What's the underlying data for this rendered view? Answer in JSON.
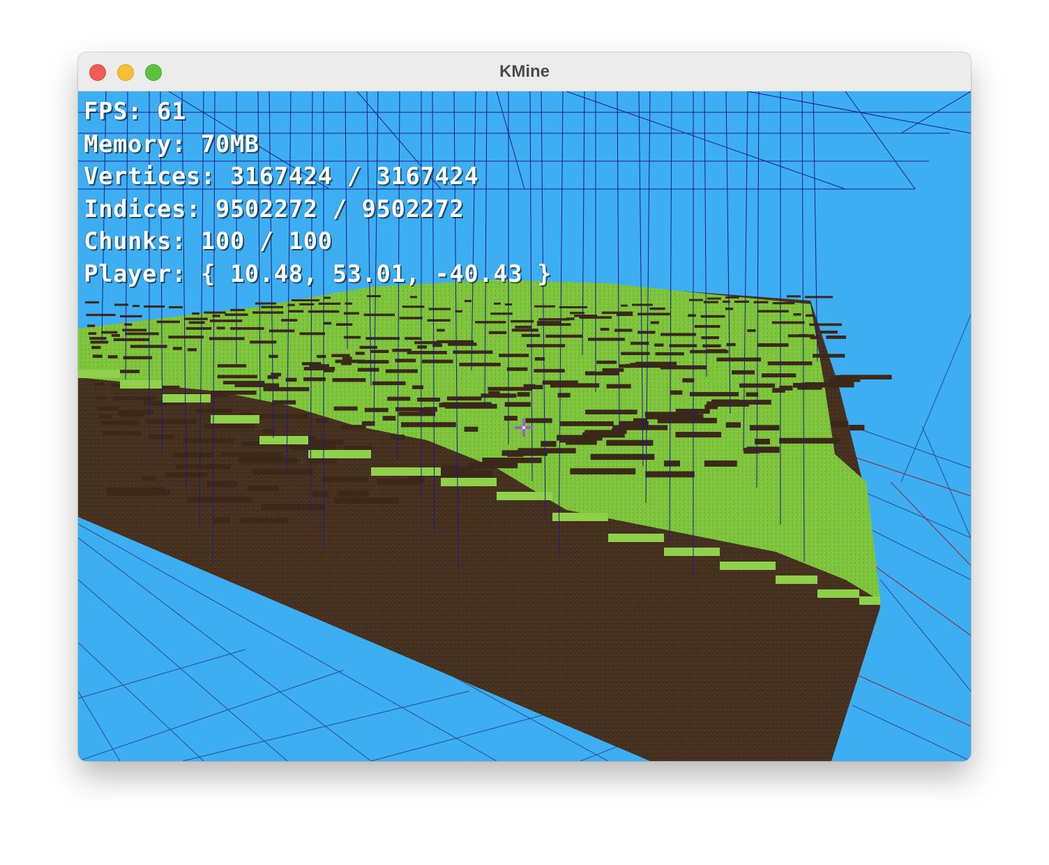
{
  "window": {
    "title": "KMine"
  },
  "hud": {
    "fps": "FPS: 61",
    "memory": "Memory: 70MB",
    "vertices": "Vertices: 3167424 / 3167424",
    "indices": "Indices: 9502272 / 9502272",
    "chunks": "Chunks: 100 / 100",
    "player": "Player: { 10.48, 53.01, -40.43 }"
  },
  "scene": {
    "sky_color": "#3daef2",
    "grass_color": "#7cc33b",
    "grass_light_color": "#8fd14a",
    "dirt_color": "#4a3220",
    "dirt_dark_color": "#3b2818",
    "chunk_border_color": "#1a1a8c",
    "floor_grid_color": "#2a5a9a",
    "floor_grid_red_color": "#8a3050",
    "crosshair_color": "#9a5fd0",
    "crosshair_icon": "crosshair-icon"
  }
}
